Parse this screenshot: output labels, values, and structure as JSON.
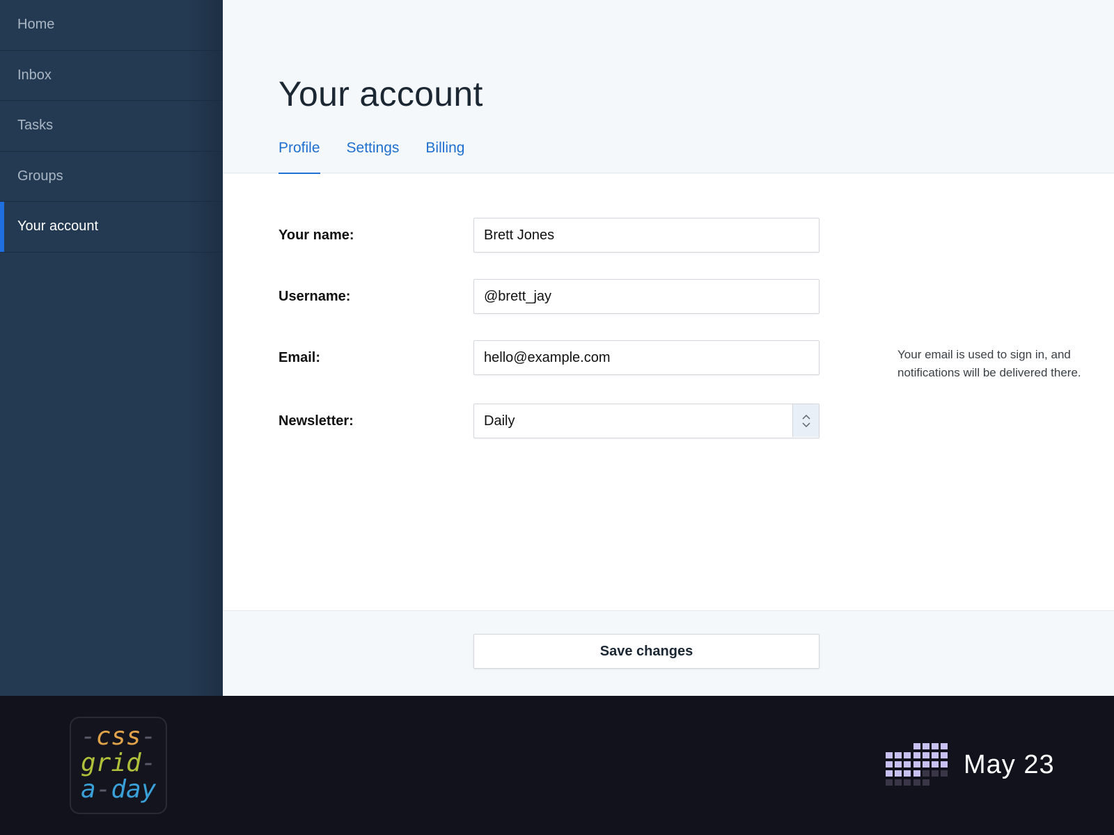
{
  "sidebar": {
    "items": [
      {
        "label": "Home"
      },
      {
        "label": "Inbox"
      },
      {
        "label": "Tasks"
      },
      {
        "label": "Groups"
      },
      {
        "label": "Your account",
        "active": true
      }
    ]
  },
  "header": {
    "title": "Your account",
    "tabs": [
      {
        "label": "Profile",
        "active": true
      },
      {
        "label": "Settings"
      },
      {
        "label": "Billing"
      }
    ]
  },
  "form": {
    "name_label": "Your name:",
    "name_value": "Brett Jones",
    "username_label": "Username:",
    "username_value": "@brett_jay",
    "email_label": "Email:",
    "email_value": "hello@example.com",
    "email_hint": "Your email is used to sign in, and notifications will be delivered there.",
    "newsletter_label": "Newsletter:",
    "newsletter_value": "Daily"
  },
  "footer": {
    "save_label": "Save changes"
  },
  "brand": {
    "logo_line1_dash_left": "-",
    "logo_line1_word": "css",
    "logo_line1_dash_right": "-",
    "logo_line2_word": "grid",
    "logo_line2_dash": "-",
    "logo_line3_word_a": "a",
    "logo_line3_dash": "-",
    "logo_line3_word_b": "day",
    "date": "May 23"
  },
  "colors": {
    "accent": "#1f6fe0",
    "sidebar_bg": "#243a52",
    "brand_bg": "#12121c"
  }
}
